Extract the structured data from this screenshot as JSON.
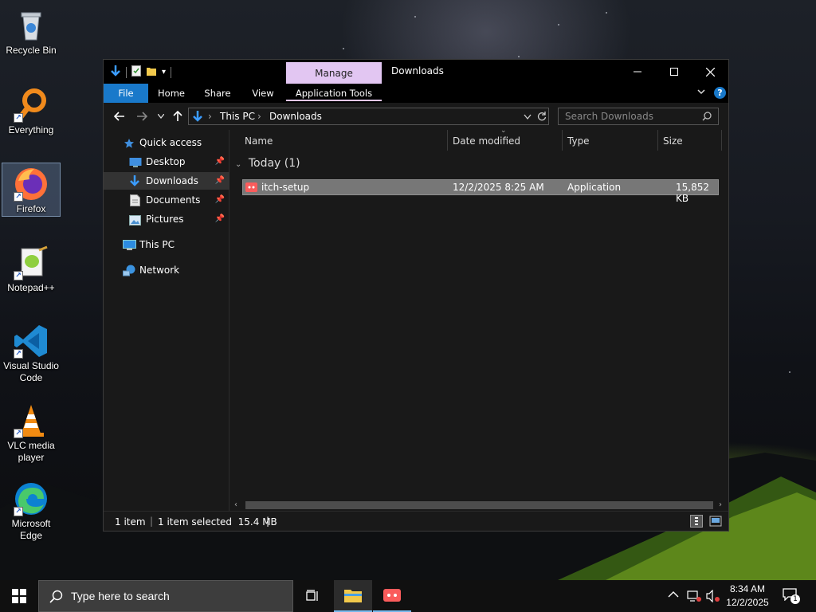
{
  "desktop": {
    "icons": [
      {
        "label": "Recycle Bin"
      },
      {
        "label": "Everything"
      },
      {
        "label": "Firefox"
      },
      {
        "label": "Notepad++"
      },
      {
        "label": "Visual Studio Code"
      },
      {
        "label": "VLC media player"
      },
      {
        "label": "Microsoft Edge"
      }
    ]
  },
  "window": {
    "title": "Downloads",
    "contextual_tab": "Manage",
    "ribbon_tabs": [
      "File",
      "Home",
      "Share",
      "View",
      "Application Tools"
    ],
    "breadcrumb": [
      "This PC",
      "Downloads"
    ],
    "search_placeholder": "Search Downloads",
    "nav": {
      "quick_access": "Quick access",
      "items": [
        "Desktop",
        "Downloads",
        "Documents",
        "Pictures"
      ],
      "this_pc": "This PC",
      "network": "Network"
    },
    "columns": [
      "Name",
      "Date modified",
      "Type",
      "Size"
    ],
    "group_label": "Today (1)",
    "files": [
      {
        "name": "itch-setup",
        "date": "12/2/2025 8:25 AM",
        "type": "Application",
        "size": "15,852 KB"
      }
    ],
    "status": {
      "count": "1 item",
      "selected": "1 item selected  15.4 MB"
    }
  },
  "taskbar": {
    "search_placeholder": "Type here to search",
    "time": "8:34 AM",
    "date": "12/2/2025",
    "notification_count": "1"
  },
  "colors": {
    "accent": "#1979ca",
    "manage_tab": "#e2c6f2",
    "selection": "#777777"
  }
}
